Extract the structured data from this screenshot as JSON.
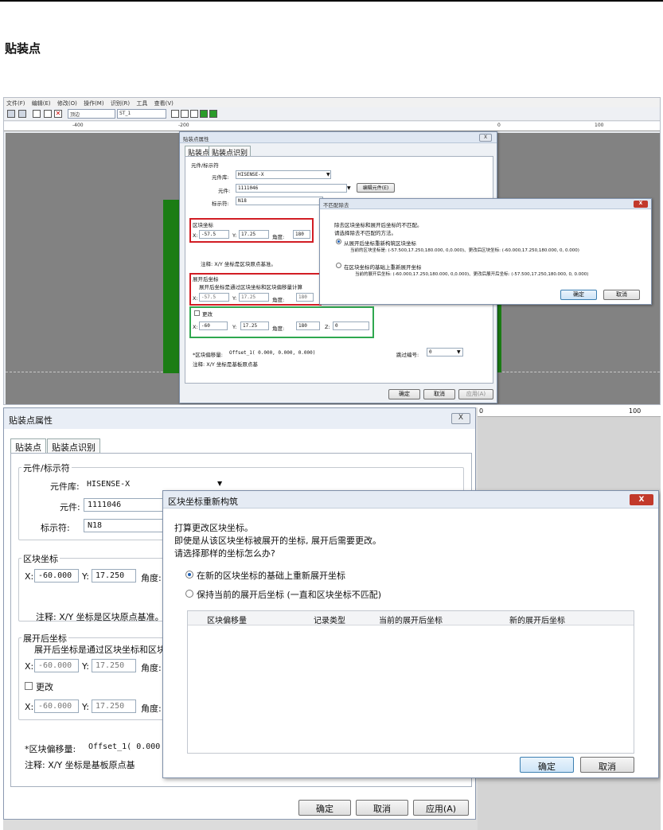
{
  "doc": {
    "title": "贴装点"
  },
  "shot1": {
    "menu": [
      "文件(F)",
      "编辑(E)",
      "修改(O)",
      "操作(M)",
      "识别(R)",
      "工具",
      "查看(V)"
    ],
    "toolbar": {
      "combo1": "顶边",
      "combo2": "ST_1"
    },
    "ruler": [
      "-400",
      "-200",
      "0",
      "100"
    ],
    "dialog": {
      "title": "贴装点属性",
      "close": "X",
      "tabs": [
        "贴装点",
        "贴装点识别"
      ],
      "group_part": "元件/标示符",
      "lib_label": "元件库:",
      "lib_value": "HISENSE-X",
      "part_label": "元件:",
      "part_value": "1111046",
      "edit_part_btn": "编辑元件(E)",
      "ref_label": "标示符:",
      "ref_value": "N18",
      "block_group": "区块坐标",
      "x_label": "X:",
      "y_label": "Y:",
      "angle_label": "角度:",
      "block_x": "-57.5",
      "block_y": "17.25",
      "block_angle": "180",
      "note1": "注释: X/Y 坐标是区块原点基准。",
      "expand_group": "展开后坐标",
      "expand_desc": "展开后坐标是通过区块坐标和区块偏移量计算",
      "exp_x": "-57.5",
      "exp_y": "17.25",
      "exp_angle": "180",
      "change_label": "更改",
      "chg_x": "-60",
      "chg_y": "17.25",
      "chg_angle": "180",
      "z_label": "Z:",
      "chg_z": "0",
      "offset_label": "*区块偏移量:",
      "offset_value": "Offset_1( 0.000, 0.000, 0.000)",
      "skip_label": "跳过编号:",
      "skip_value": "0",
      "note2": "注释: X/Y 坐标是基板原点基",
      "ok": "确定",
      "cancel": "取消",
      "apply": "应用(A)"
    },
    "mismatch": {
      "title": "不匹配除去",
      "close": "X",
      "line1": "除去区块坐标和展开后坐标的不匹配。",
      "line2": "请选择除去不匹配的方法。",
      "opt1": "从展开后坐标重新构筑区块坐标",
      "opt1_detail": "当前的区块坐标是: (-57.500,17.250,180.000, 0,0.000)、更改后区块坐标: (-60.000,17.250,180.000, 0, 0.000)",
      "opt2": "在区块坐标的基础上重新展开坐标",
      "opt2_detail": "当前的展开后坐标: (-60.000,17.250,180.000, 0,0.000)、更改后展开后坐标: (-57.500,17.250,180.000, 0, 0.000)",
      "ok": "确定",
      "cancel": "取消"
    }
  },
  "shot2": {
    "ruler": [
      "0",
      "100"
    ],
    "dialog": {
      "title": "贴装点属性",
      "close": "X",
      "tabs": [
        "贴装点",
        "贴装点识别"
      ],
      "group_part": "元件/标示符",
      "lib_label": "元件库:",
      "lib_value": "HISENSE-X",
      "part_label": "元件:",
      "part_value": "1111046",
      "ref_label": "标示符:",
      "ref_value": "N18",
      "block_group": "区块坐标",
      "x_label": "X:",
      "y_label": "Y:",
      "angle_label": "角度:",
      "block_x": "-60.000",
      "block_y": "17.250",
      "note1": "注释: X/Y 坐标是区块原点基准。",
      "expand_group": "展开后坐标",
      "expand_desc": "展开后坐标是通过区块坐标和区块",
      "exp_x": "-60.000",
      "exp_y": "17.250",
      "change_label": "更改",
      "chg_x": "-60.000",
      "chg_y": "17.250",
      "offset_label": "*区块偏移量:",
      "offset_value": "Offset_1(  0.000",
      "note2": "注释: X/Y 坐标是基板原点基",
      "ok": "确定",
      "cancel": "取消",
      "apply": "应用(A)"
    },
    "rebuild": {
      "title": "区块坐标重新构筑",
      "close": "X",
      "line1": "打算更改区块坐标。",
      "line2": "即使是从该区块坐标被展开的坐标, 展开后需要更改。",
      "line3": "请选择那样的坐标怎么办?",
      "opt1": "在新的区块坐标的基础上重新展开坐标",
      "opt2": "保持当前的展开后坐标 (一直和区块坐标不匹配)",
      "columns": [
        "区块偏移量",
        "记录类型",
        "当前的展开后坐标",
        "新的展开后坐标"
      ],
      "ok": "确定",
      "cancel": "取消"
    }
  }
}
